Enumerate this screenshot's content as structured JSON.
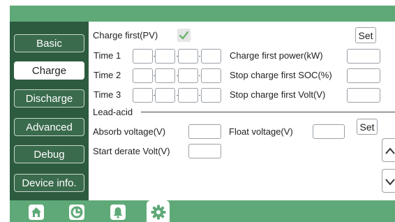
{
  "sidebar": {
    "items": [
      {
        "label": "Basic",
        "active": false
      },
      {
        "label": "Charge",
        "active": true
      },
      {
        "label": "Discharge",
        "active": false
      },
      {
        "label": "Advanced",
        "active": false
      },
      {
        "label": "Debug",
        "active": false
      },
      {
        "label": "Device info.",
        "active": false
      }
    ]
  },
  "charge": {
    "charge_first_pv_label": "Charge first(PV)",
    "charge_first_pv_checked": true,
    "set_label": "Set",
    "time_rows": [
      {
        "label": "Time 1",
        "field_label": "Charge first power(kW)",
        "field_value": ""
      },
      {
        "label": "Time 2",
        "field_label": "Stop charge first SOC(%)",
        "field_value": ""
      },
      {
        "label": "Time 3",
        "field_label": "Stop charge first Volt(V)",
        "field_value": ""
      }
    ],
    "lead_acid_label": "Lead-acid",
    "absorb_voltage_label": "Absorb voltage(V)",
    "absorb_voltage_value": "",
    "float_voltage_label": "Float voltage(V)",
    "float_voltage_value": "",
    "lead_set_label": "Set",
    "start_derate_label": "Start derate Volt(V)",
    "start_derate_value": ""
  },
  "bottom_nav": [
    {
      "icon": "home-icon"
    },
    {
      "icon": "pie-chart-icon"
    },
    {
      "icon": "bell-icon"
    },
    {
      "icon": "gear-icon",
      "active": true
    }
  ],
  "colors": {
    "header_green": "#5fa978",
    "sidebar_dark_green": "#2d5b3f",
    "checkmark_green": "#6db36f"
  }
}
